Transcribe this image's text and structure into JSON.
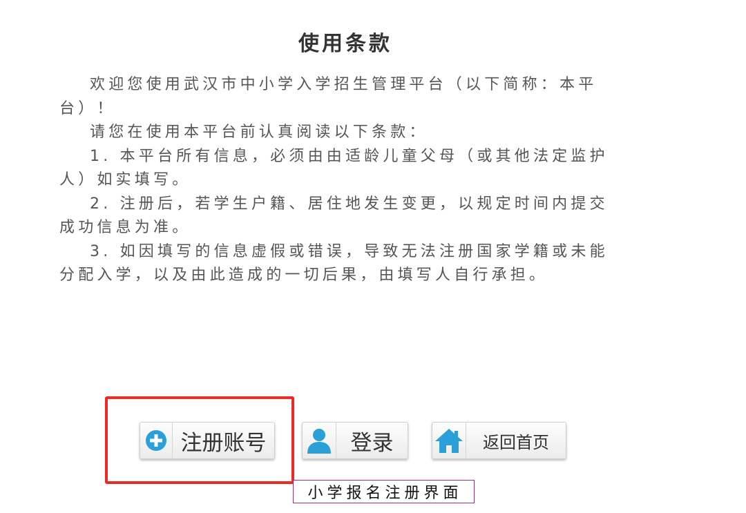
{
  "page": {
    "title": "使用条款"
  },
  "terms": {
    "paragraphs": [
      "欢迎您使用武汉市中小学入学招生管理平台（以下简称：本平台）！",
      "请您在使用本平台前认真阅读以下条款：",
      "1. 本平台所有信息，必须由由适龄儿童父母（或其他法定监护人）如实填写。",
      "2. 注册后，若学生户籍、居住地发生变更，以规定时间内提交成功信息为准。",
      "3. 如因填写的信息虚假或错误，导致无法注册国家学籍或未能分配入学，以及由此造成的一切后果，由填写人自行承担。"
    ]
  },
  "buttons": {
    "register": {
      "label": "注册账号",
      "icon": "plus-circle-icon"
    },
    "login": {
      "label": "登录",
      "icon": "user-icon"
    },
    "home": {
      "label": "返回首页",
      "icon": "home-icon"
    }
  },
  "annotation": {
    "caption": "小学报名注册界面",
    "highlight_color": "#ee2a24"
  },
  "colors": {
    "icon_blue": "#2a9fd8",
    "text": "#555555"
  }
}
